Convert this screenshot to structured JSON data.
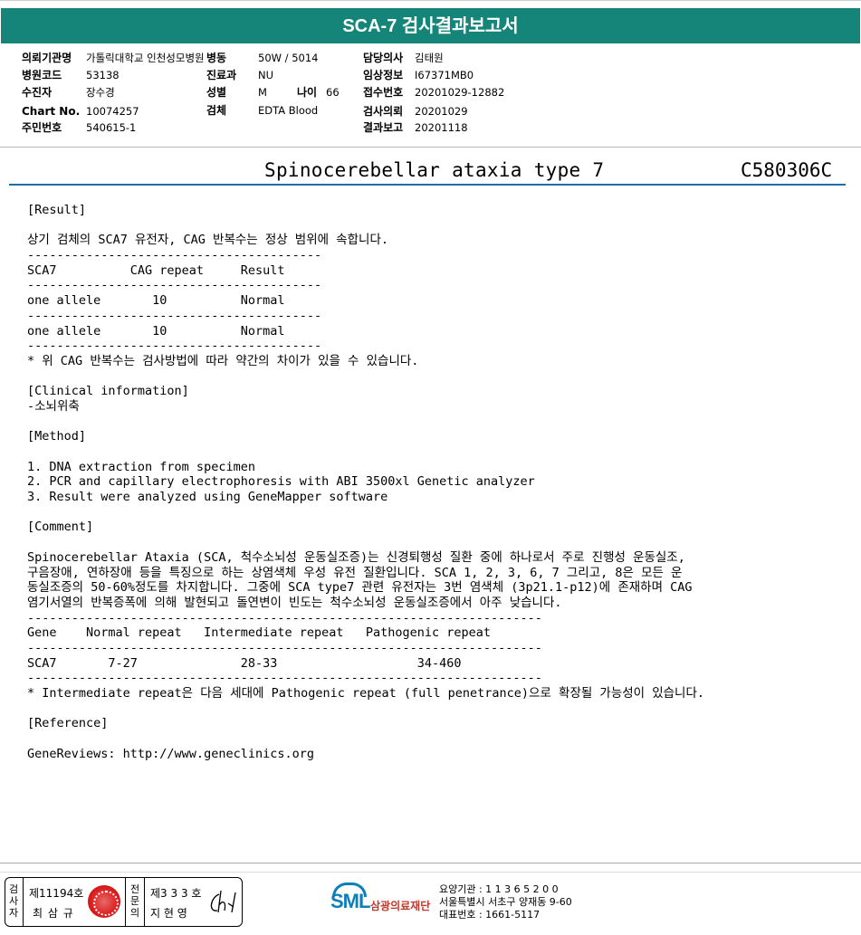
{
  "title": "SCA-7 검사결과보고서",
  "header": {
    "col1": [
      {
        "label": "의뢰기관명",
        "value": "가톨릭대학교 인천성모병원"
      },
      {
        "label": "병원코드",
        "value": "53138"
      },
      {
        "label": "수진자",
        "value": "장수경"
      },
      {
        "label": "Chart No.",
        "value": "10074257"
      },
      {
        "label": "주민번호",
        "value": "540615-1"
      }
    ],
    "col2": [
      {
        "label": "병동",
        "value": "50W / 5014"
      },
      {
        "label": "진료과",
        "value": "NU"
      },
      {
        "label": "성별",
        "value": "M"
      },
      {
        "label": "검체",
        "value": "EDTA Blood"
      }
    ],
    "age": {
      "label": "나이",
      "value": "66"
    },
    "col3": [
      {
        "label": "담당의사",
        "value": "김태원"
      },
      {
        "label": "임상정보",
        "value": "I67371MB0"
      },
      {
        "label": "접수번호",
        "value": "20201029-12882"
      },
      {
        "label": "검사의뢰",
        "value": "20201029"
      },
      {
        "label": "결과보고",
        "value": "20201118"
      }
    ]
  },
  "test": {
    "name": "Spinocerebellar ataxia type 7",
    "code": "C580306C"
  },
  "report_lines": [
    "[Result]",
    "",
    "상기 검체의 SCA7 유전자, CAG 반복수는 정상 범위에 속합니다.",
    "----------------------------------------",
    "SCA7          CAG repeat     Result",
    "----------------------------------------",
    "one allele       10          Normal",
    "----------------------------------------",
    "one allele       10          Normal",
    "----------------------------------------",
    "* 위 CAG 반복수는 검사방법에 따라 약간의 차이가 있을 수 있습니다.",
    "",
    "[Clinical information]",
    "-소뇌위축",
    "",
    "[Method]",
    "",
    "1. DNA extraction from specimen",
    "2. PCR and capillary electrophoresis with ABI 3500xl Genetic analyzer",
    "3. Result were analyzed using GeneMapper software",
    "",
    "[Comment]",
    "",
    "Spinocerebellar Ataxia (SCA, 척수소뇌성 운동실조증)는 신경퇴행성 질환 중에 하나로서 주로 진행성 운동실조,",
    "구음장애, 연하장애 등을 특징으로 하는 상염색체 우성 유전 질환입니다. SCA 1, 2, 3, 6, 7 그리고, 8은 모든 운",
    "동실조증의 50-60%정도를 차지합니다. 그중에 SCA type7 관련 유전자는 3번 염색체 (3p21.1-p12)에 존재하며 CAG",
    "염기서열의 반복증폭에 의해 발현되고 돌연변이 빈도는 척수소뇌성 운동실조증에서 아주 낮습니다.",
    "----------------------------------------------------------------------",
    "Gene    Normal repeat   Intermediate repeat   Pathogenic repeat",
    "----------------------------------------------------------------------",
    "SCA7       7-27              28-33                   34-460",
    "----------------------------------------------------------------------",
    "* Intermediate repeat은 다음 세대에 Pathogenic repeat (full penetrance)으로 확장될 가능성이 있습니다.",
    "",
    "[Reference]",
    "",
    "GeneReviews: http://www.geneclinics.org"
  ],
  "sign": {
    "label1": "검사자",
    "no1": "제11194호",
    "name1": "최 삼 규",
    "label2": "전문의",
    "no2": "제3 3 3 호",
    "name2": "지 현 영"
  },
  "logo": {
    "sml": "SML",
    "name": "삼광의료재단"
  },
  "contact": [
    "요양기관 : 1 1 3 6 5 2 0 0",
    "서울특별시 서초구 양재동 9-60",
    "대표번호 : 1661-5117"
  ]
}
